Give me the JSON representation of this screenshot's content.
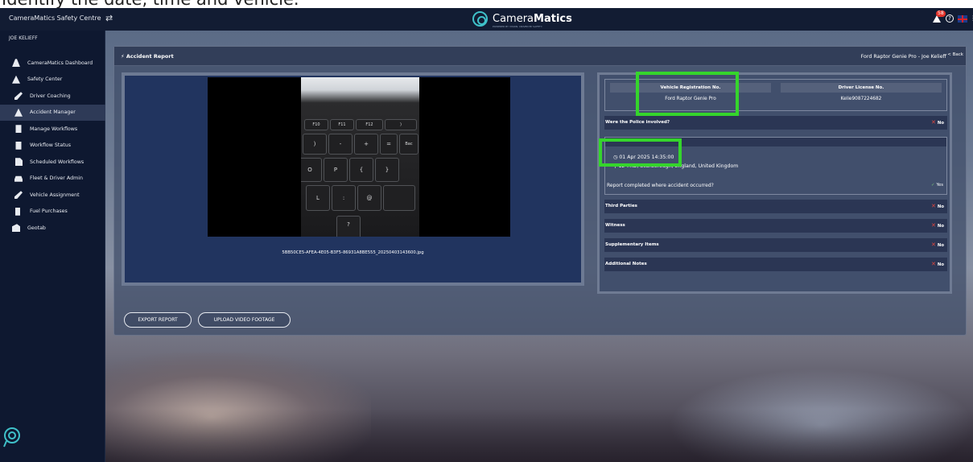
{
  "caption": "Identify the date, time and vehicle.",
  "topbar": {
    "app_name": "CameraMatics Safety Centre",
    "brand_light": "Camera",
    "brand_bold": "Matics",
    "brand_tagline": "POWERED BY VISION. DRIVEN BY SAFETY.",
    "notification_count": "58",
    "help_label": "?"
  },
  "sidebar": {
    "user": "JOE KELIEFF",
    "items": [
      {
        "label": "CameraMatics Dashboard",
        "icon": "road-icon"
      },
      {
        "label": "Safety Center",
        "icon": "warning-icon"
      },
      {
        "label": "Driver Coaching",
        "icon": "coach-icon"
      },
      {
        "label": "Accident Manager",
        "icon": "alert-icon",
        "active": true
      },
      {
        "label": "Manage Workflows",
        "icon": "building-icon"
      },
      {
        "label": "Workflow Status",
        "icon": "building-icon"
      },
      {
        "label": "Scheduled Workflows",
        "icon": "document-icon"
      },
      {
        "label": "Fleet & Driver Admin",
        "icon": "car-icon"
      },
      {
        "label": "Vehicle Assignment",
        "icon": "person-icon"
      },
      {
        "label": "Fuel Purchases",
        "icon": "fuel-icon"
      },
      {
        "label": "Geotab",
        "icon": "geotab-icon"
      }
    ]
  },
  "panel": {
    "title": "Accident Report",
    "context": "Ford Raptor Genie Pro - Joe Kelieff",
    "back_label": "< Back"
  },
  "media": {
    "filename": "5BB50CE5-AFEA-4E05-B3F5-86931A8BE555_20250403143600.jpg",
    "keys": [
      "F10",
      "F11",
      "F12",
      ")",
      "0",
      "-",
      "+",
      "=",
      "Bac",
      "O",
      "P",
      "{",
      "[",
      "}",
      "]",
      "L",
      ":",
      ";",
      "@",
      "'",
      "?"
    ]
  },
  "details": {
    "vehicle_header": "Vehicle Registration No.",
    "vehicle_value": "Ford Raptor Genie Pro",
    "license_header": "Driver License No.",
    "license_value": "Kelie9087224682",
    "police_label": "Were the Police involved?",
    "police_value": "No",
    "datetime": "01 Apr 2025 14:35:00",
    "address": "12 7RD, Scarborough, England, United Kingdom",
    "report_location_label": "Report completed where accident occurred?",
    "report_location_value": "Yes",
    "third_parties_label": "Third Parties",
    "third_parties_value": "No",
    "witness_label": "Witness",
    "witness_value": "No",
    "supplementary_label": "Supplementary Items",
    "supplementary_value": "No",
    "notes_label": "Additional Notes",
    "notes_value": "No"
  },
  "buttons": {
    "export": "EXPORT REPORT",
    "upload": "UPLOAD VIDEO FOOTAGE"
  },
  "colors": {
    "highlight": "#35d52c",
    "no_mark": "#e1463e",
    "yes_mark": "#7bc47a",
    "topbar": "#121c33"
  }
}
